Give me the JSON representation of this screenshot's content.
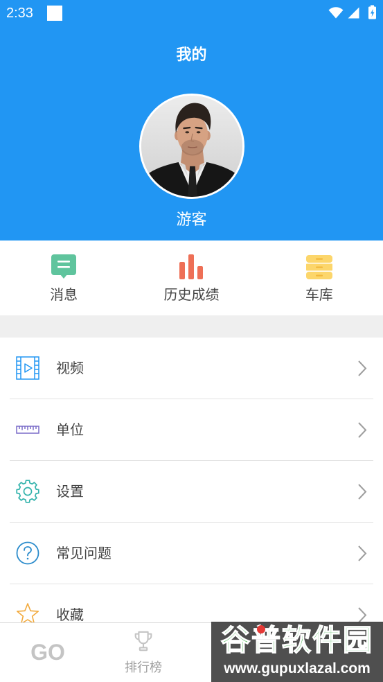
{
  "colors": {
    "primary": "#2196F3",
    "section_gap": "#EFEFEF",
    "divider": "#E2E2E2",
    "text": "#444444",
    "chevron": "#9E9E9E",
    "nav_inactive": "#C4C4C4",
    "badge": "#E53935"
  },
  "status_bar": {
    "time": "2:33",
    "left_icons": [
      "notification-square-icon"
    ],
    "right_icons": [
      "wifi-icon",
      "signal-icon",
      "battery-charging-icon"
    ]
  },
  "header": {
    "title": "我的",
    "avatar": "avatar-photo",
    "username": "游客"
  },
  "quick_actions": [
    {
      "label": "消息",
      "icon": "message-icon",
      "color": "#5FC49D"
    },
    {
      "label": "历史成绩",
      "icon": "bar-chart-icon",
      "color": "#EE6F56"
    },
    {
      "label": "车库",
      "icon": "garage-drawer-icon",
      "color": "#FCD66B"
    }
  ],
  "menu": [
    {
      "label": "视频",
      "icon": "video-icon",
      "color": "#2196F3",
      "trailing_icon": "chevron-right-icon"
    },
    {
      "label": "单位",
      "icon": "ruler-icon",
      "color": "#7A6CC9",
      "trailing_icon": "chevron-right-icon"
    },
    {
      "label": "设置",
      "icon": "gear-icon",
      "color": "#33B3AC",
      "trailing_icon": "chevron-right-icon"
    },
    {
      "label": "常见问题",
      "icon": "question-icon",
      "color": "#2A8BCB",
      "trailing_icon": "chevron-right-icon"
    },
    {
      "label": "收藏",
      "icon": "star-icon",
      "color": "#F2A93B",
      "trailing_icon": "chevron-right-icon"
    }
  ],
  "bottom_nav": [
    {
      "label": "GO"
    },
    {
      "label": "排行榜",
      "icon": "trophy-icon"
    },
    {
      "badge": "dot"
    },
    {
      "icon": "user-icon"
    }
  ],
  "watermark": {
    "title": "谷普软件园",
    "url": "www.gupuxlazal.com"
  }
}
